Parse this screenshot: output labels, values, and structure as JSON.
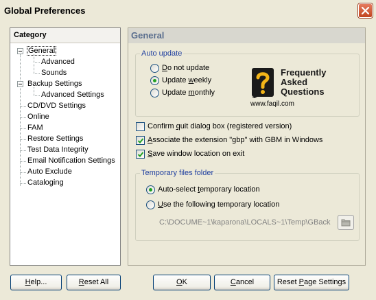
{
  "window": {
    "title": "Global Preferences"
  },
  "sidebar": {
    "header": "Category",
    "items": [
      {
        "label": "General",
        "level": 0,
        "expanded": true,
        "selected": true
      },
      {
        "label": "Advanced",
        "level": 2
      },
      {
        "label": "Sounds",
        "level": 2
      },
      {
        "label": "Backup Settings",
        "level": 0,
        "expanded": true
      },
      {
        "label": "Advanced Settings",
        "level": 2
      },
      {
        "label": "CD/DVD Settings",
        "level": 0
      },
      {
        "label": "Online",
        "level": 0
      },
      {
        "label": "FAM",
        "level": 0
      },
      {
        "label": "Restore Settings",
        "level": 0
      },
      {
        "label": "Test Data Integrity",
        "level": 0
      },
      {
        "label": "Email Notification Settings",
        "level": 0
      },
      {
        "label": "Auto Exclude",
        "level": 0
      },
      {
        "label": "Cataloging",
        "level": 0
      }
    ]
  },
  "main": {
    "title": "General",
    "auto_update": {
      "legend": "Auto update",
      "options": [
        {
          "pre": "",
          "u": "D",
          "post": "o not update",
          "selected": false
        },
        {
          "pre": "Update ",
          "u": "w",
          "post": "eekly",
          "selected": true
        },
        {
          "pre": "Update ",
          "u": "m",
          "post": "onthly",
          "selected": false
        }
      ]
    },
    "faq": {
      "line1": "Frequently",
      "line2": "Asked",
      "line3": "Questions",
      "url": "www.faqil.com"
    },
    "checkboxes": [
      {
        "pre": "Confirm ",
        "u": "q",
        "post": "uit dialog box (registered version)",
        "checked": false
      },
      {
        "pre": "",
        "u": "A",
        "post": "ssociate the extension \"gbp\" with GBM in Windows",
        "checked": true
      },
      {
        "pre": "",
        "u": "S",
        "post": "ave window location on exit",
        "checked": true
      }
    ],
    "temp_folder": {
      "legend": "Temporary files folder",
      "options": [
        {
          "pre": "Auto-select ",
          "u": "t",
          "post": "emporary location",
          "selected": true
        },
        {
          "pre": "",
          "u": "U",
          "post": "se the following temporary location",
          "selected": false
        }
      ],
      "path_value": "C:\\DOCUME~1\\kaparona\\LOCALS~1\\Temp\\GBack"
    }
  },
  "footer": {
    "help": {
      "pre": "",
      "u": "H",
      "post": "elp..."
    },
    "reset_all": {
      "pre": "",
      "u": "R",
      "post": "eset All"
    },
    "ok": {
      "pre": "",
      "u": "O",
      "post": "K"
    },
    "cancel": {
      "pre": "",
      "u": "C",
      "post": "ancel"
    },
    "reset_page": {
      "pre": "Reset ",
      "u": "P",
      "post": "age Settings"
    }
  },
  "colors": {
    "legend_text": "#1f3f9f",
    "header_title": "#5a6e8e",
    "radio_dot": "#21a121",
    "checkmark": "#21a121"
  }
}
